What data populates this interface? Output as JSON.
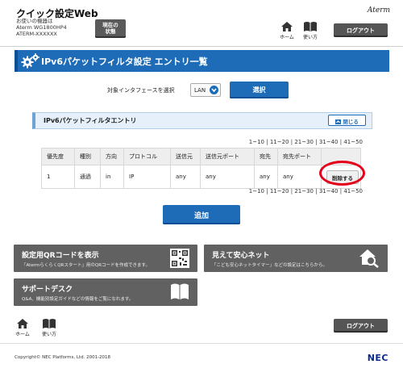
{
  "header": {
    "title": "クイック設定Web",
    "device_line1": "お使いの機器は",
    "device_line2": "Aterm WG1800HP4",
    "device_line3": "ATERM-XXXXXX",
    "status_line1": "現在の",
    "status_line2": "状態",
    "brand": "Aterm",
    "home_label": "ホーム",
    "help_label": "使い方",
    "logout_label": "ログアウト"
  },
  "page": {
    "title": "IPv6パケットフィルタ設定 エントリ一覧"
  },
  "interface": {
    "label": "対象インタフェースを選択",
    "selected": "LAN",
    "select_button": "選択"
  },
  "panel": {
    "title": "IPv6パケットフィルタエントリ",
    "close_label": "閉じる"
  },
  "pagination": {
    "ranges": [
      "1~10",
      "11~20",
      "21~30",
      "31~40",
      "41~50"
    ],
    "separator": " | "
  },
  "table": {
    "headers": [
      "優先度",
      "種別",
      "方向",
      "プロトコル",
      "送信元",
      "送信元ポート",
      "宛先",
      "宛先ポート",
      ""
    ],
    "rows": [
      [
        "1",
        "通過",
        "in",
        "IP",
        "any",
        "any",
        "any",
        "any",
        "削除する"
      ]
    ]
  },
  "actions": {
    "add_label": "追加"
  },
  "tiles": {
    "qr_title": "設定用QRコードを表示",
    "qr_desc": "「AtermらくらくQRスタート」用のQRコードを作成できます。",
    "safety_title": "見えて安心ネット",
    "safety_desc": "「こども安心ネットタイマー」などの設定はこちらから。",
    "support_title": "サポートデスク",
    "support_desc": "Q&A、機能別設定ガイドなどの情報をご覧になれます。"
  },
  "footer": {
    "home_label": "ホーム",
    "help_label": "使い方",
    "logout_label": "ログアウト",
    "copyright": "Copyright© NEC Platforms, Ltd. 2001-2018",
    "company": "NEC"
  },
  "colors": {
    "primary_blue": "#1e6cb8",
    "dark_button": "#555555",
    "tile_gray": "#616161",
    "highlight_red": "#e4001b"
  }
}
